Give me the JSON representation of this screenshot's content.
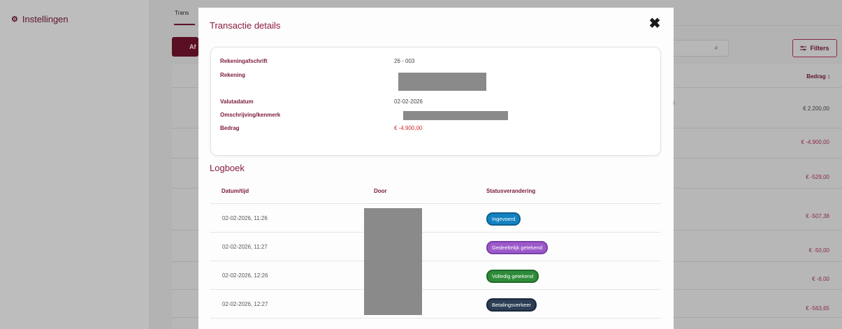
{
  "sidebar": {
    "nav_item_icon": "gear-icon",
    "nav_item_label": "Instellingen"
  },
  "background": {
    "tab_label": "Trans",
    "add_button_label": "Af",
    "search_icon": "🔍",
    "filters_icon": "filter-icon",
    "filters_label": "Filters",
    "column_header": "Bedrag ↕",
    "fragment_text": "524",
    "amounts": [
      "€ 2.200,00",
      "€ -4.900,00",
      "€ -529,00",
      "€ -507,38",
      "€ -50,00",
      "€ -6,00",
      "€ -563,65"
    ]
  },
  "modal": {
    "title": "Transactie details",
    "close_symbol": "✖",
    "details": [
      {
        "label": "Rekeningafschrift",
        "value": "26 - 003"
      },
      {
        "label": "Rekening",
        "value": ""
      },
      {
        "label": "Valutadatum",
        "value": "02-02-2026"
      },
      {
        "label": "Omschrijving/kenmerk",
        "value": ""
      },
      {
        "label": "Bedrag",
        "value": "€ -4.900,00"
      }
    ],
    "log_title": "Logboek",
    "log_headers": [
      "Datum/tijd",
      "Door",
      "Statusverandering"
    ],
    "log_rows": [
      {
        "datetime": "02-02-2026, 11:26",
        "status": "Ingevoerd"
      },
      {
        "datetime": "02-02-2026, 11:27",
        "status": "Gedeeltelijk getekend"
      },
      {
        "datetime": "02-02-2026, 12:26",
        "status": "Volledig getekend"
      },
      {
        "datetime": "02-02-2026, 12:27",
        "status": "Betalingsverkeer"
      }
    ]
  },
  "colors": {
    "brand": "#8a1c3c",
    "badge_ingevoerd": "#1482c0",
    "badge_gedeeltelijk": "#9b59c9",
    "badge_volledig": "#2e8b3a",
    "badge_betalingsverkeer": "#2c3e55",
    "negative_amount": "#d02c2c"
  }
}
